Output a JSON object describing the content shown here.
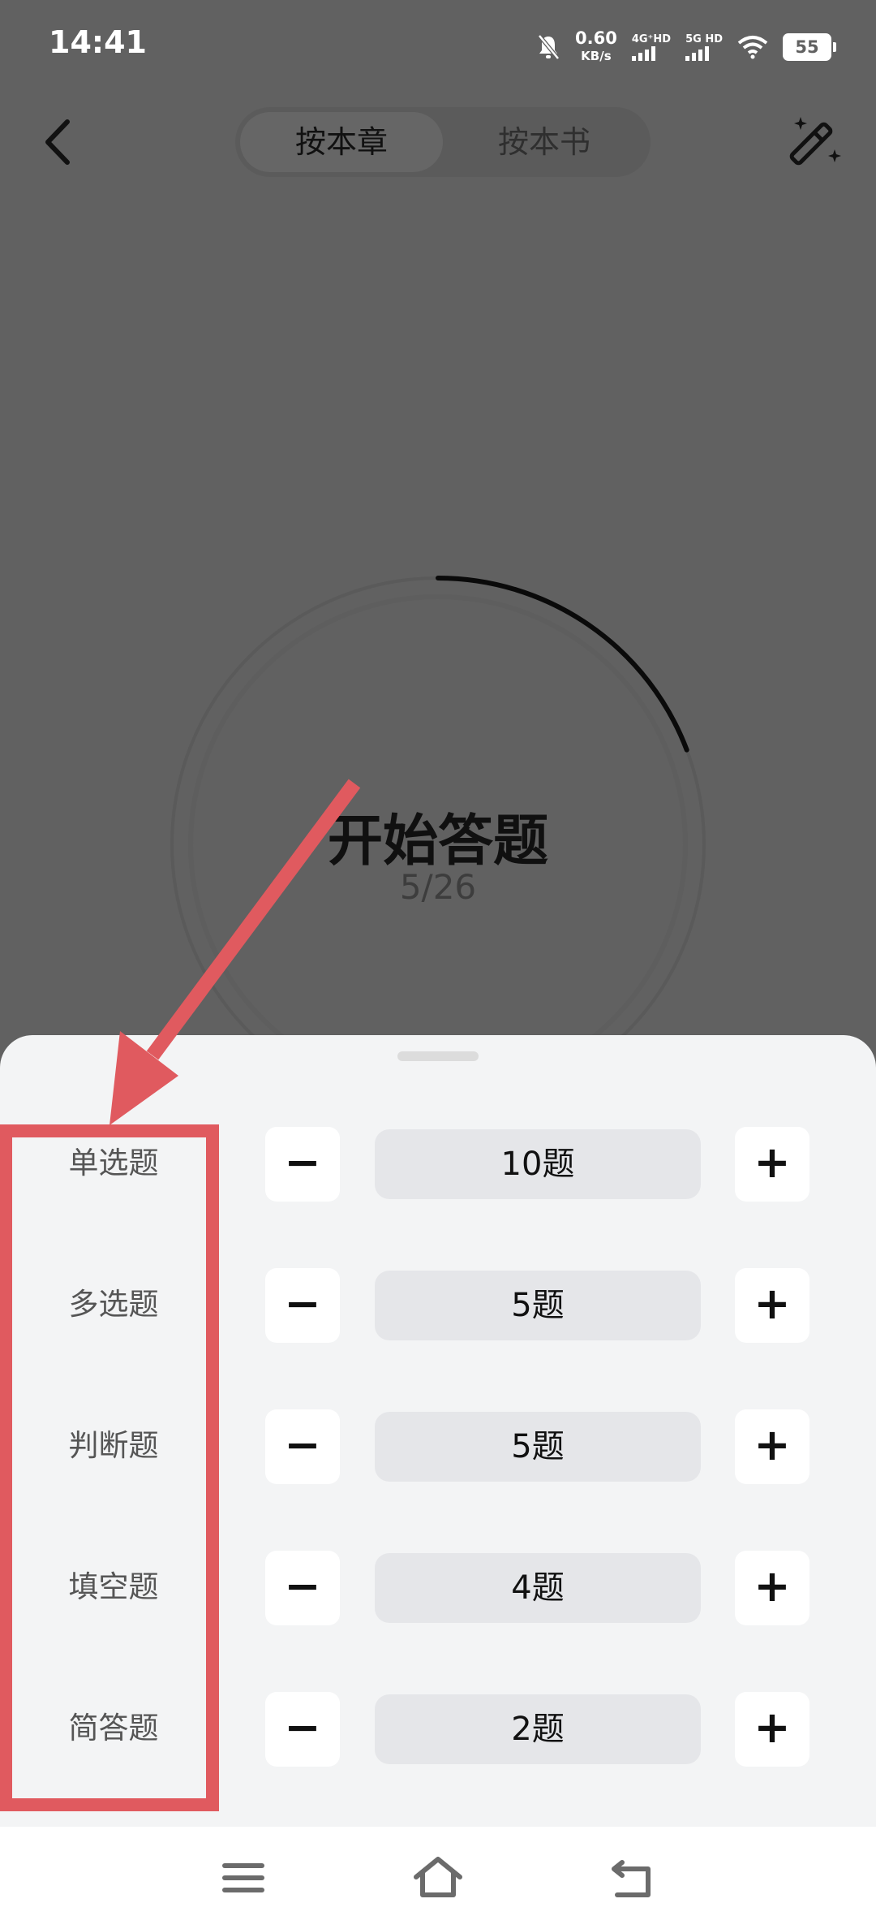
{
  "status_bar": {
    "time": "14:41",
    "net_speed_value": "0.60",
    "net_speed_unit": "KB/s",
    "signal1_label": "4G⁺HD",
    "signal2_label": "5G HD",
    "battery": "55",
    "icons": [
      "bell-muted-icon",
      "signal-icon",
      "signal-icon",
      "wifi-icon",
      "battery-icon"
    ]
  },
  "header": {
    "tabs": [
      {
        "label": "按本章",
        "active": true
      },
      {
        "label": "按本书",
        "active": false
      }
    ],
    "icons": [
      "back-icon",
      "magic-wand-icon"
    ]
  },
  "main": {
    "start_label": "开始答题",
    "progress_text": "5/26",
    "progress_ratio": 0.1923
  },
  "sheet": {
    "rows": [
      {
        "label": "单选题",
        "count": "10题"
      },
      {
        "label": "多选题",
        "count": "5题"
      },
      {
        "label": "判断题",
        "count": "5题"
      },
      {
        "label": "填空题",
        "count": "4题"
      },
      {
        "label": "简答题",
        "count": "2题"
      }
    ],
    "minus_symbol": "−",
    "plus_symbol": "+"
  },
  "annotation": {
    "color": "#e05a5f"
  },
  "navbar": {
    "icons": [
      "menu-icon",
      "home-icon",
      "back-nav-icon"
    ]
  },
  "colors": {
    "overlay": "#616161",
    "sheet": "#f3f4f5",
    "field": "#e5e6e9"
  }
}
